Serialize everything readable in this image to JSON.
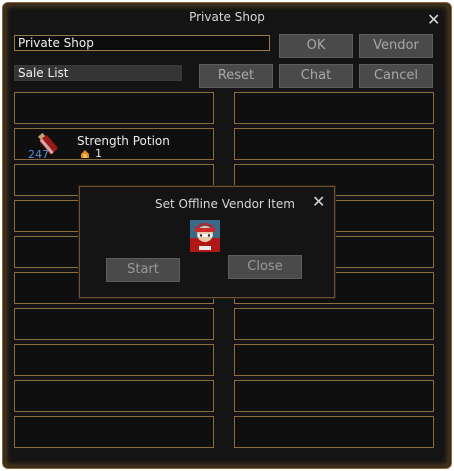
{
  "window": {
    "title": "Private Shop",
    "close_icon": "close-icon"
  },
  "shop_name_field": {
    "value": "Private Shop"
  },
  "sale_list_field": {
    "value": "Sale List"
  },
  "buttons": {
    "ok": "OK",
    "vendor": "Vendor",
    "reset": "Reset",
    "chat": "Chat",
    "cancel": "Cancel"
  },
  "items": [
    {
      "name": "Strength Potion",
      "stack_count": "247",
      "price": "1",
      "icon": "strength-potion-icon",
      "price_icon": "currency-icon"
    }
  ],
  "dialog": {
    "title": "Set Offline Vendor Item",
    "start_label": "Start",
    "close_label": "Close",
    "avatar_icon": "vendor-avatar-icon"
  },
  "colors": {
    "border_gold": "#8d6d3d",
    "background": "#141414",
    "button_gray": "#4a4a4a",
    "count_blue": "#5a8ad8"
  }
}
